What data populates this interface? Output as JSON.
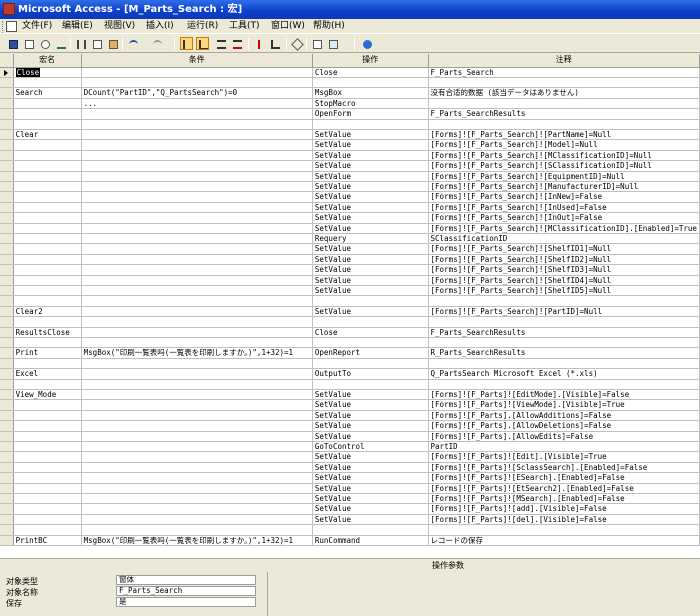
{
  "window": {
    "title": "Microsoft Access - [M_Parts_Search : 宏]"
  },
  "menu": [
    {
      "label": "文件(F)",
      "name": "file"
    },
    {
      "label": "编辑(E)",
      "name": "edit"
    },
    {
      "label": "视图(V)",
      "name": "view"
    },
    {
      "label": "插入(I)",
      "name": "insert"
    },
    {
      "label": "运行(R)",
      "name": "run"
    },
    {
      "label": "工具(T)",
      "name": "tools"
    },
    {
      "label": "窗口(W)",
      "name": "window"
    },
    {
      "label": "帮助(H)",
      "name": "help"
    }
  ],
  "toolbar": {
    "icons": [
      "save-icon",
      "print-icon",
      "print-preview-icon",
      "spell-check-icon",
      "cut-icon",
      "copy-icon",
      "paste-icon",
      "undo-icon",
      "redo-icon",
      "macro-names-icon",
      "conditions-icon",
      "insert-rows-icon",
      "delete-rows-icon",
      "run-icon",
      "single-step-icon",
      "build-icon",
      "database-window-icon",
      "new-object-icon",
      "help-icon"
    ],
    "colors": {
      "highlight": "#ffd67a"
    }
  },
  "grid": {
    "headers": {
      "macro_name": "宏名",
      "condition": "条件",
      "action": "操作",
      "comment": "注释"
    },
    "rows": [
      {
        "name": "Close",
        "cond": "",
        "action": "Close",
        "comment": "F_Parts_Search",
        "current": true
      },
      {
        "name": "",
        "cond": "",
        "action": "",
        "comment": ""
      },
      {
        "name": "Search",
        "cond": "DCount(\"PartID\",\"Q_PartsSearch\")=0",
        "action": "MsgBox",
        "comment": "没有合适的数据 (該当データはありません)"
      },
      {
        "name": "",
        "cond": "...",
        "action": "StopMacro",
        "comment": ""
      },
      {
        "name": "",
        "cond": "",
        "action": "OpenForm",
        "comment": "F_Parts_SearchResults"
      },
      {
        "name": "",
        "cond": "",
        "action": "",
        "comment": ""
      },
      {
        "name": "Clear",
        "cond": "",
        "action": "SetValue",
        "comment": "[Forms]![F_Parts_Search]![PartName]=Null"
      },
      {
        "name": "",
        "cond": "",
        "action": "SetValue",
        "comment": "[Forms]![F_Parts_Search]![Model]=Null"
      },
      {
        "name": "",
        "cond": "",
        "action": "SetValue",
        "comment": "[Forms]![F_Parts_Search]![MClassificationID]=Null"
      },
      {
        "name": "",
        "cond": "",
        "action": "SetValue",
        "comment": "[Forms]![F_Parts_Search]![SClassificationID]=Null"
      },
      {
        "name": "",
        "cond": "",
        "action": "SetValue",
        "comment": "[Forms]![F_Parts_Search]![EquipmentID]=Null"
      },
      {
        "name": "",
        "cond": "",
        "action": "SetValue",
        "comment": "[Forms]![F_Parts_Search]![ManufacturerID]=Null"
      },
      {
        "name": "",
        "cond": "",
        "action": "SetValue",
        "comment": "[Forms]![F_Parts_Search]![InNew]=False"
      },
      {
        "name": "",
        "cond": "",
        "action": "SetValue",
        "comment": "[Forms]![F_Parts_Search]![InUsed]=False"
      },
      {
        "name": "",
        "cond": "",
        "action": "SetValue",
        "comment": "[Forms]![F_Parts_Search]![InOut]=False"
      },
      {
        "name": "",
        "cond": "",
        "action": "SetValue",
        "comment": "[Forms]![F_Parts_Search]![MClassificationID].[Enabled]=True"
      },
      {
        "name": "",
        "cond": "",
        "action": "Requery",
        "comment": "SClassificationID"
      },
      {
        "name": "",
        "cond": "",
        "action": "SetValue",
        "comment": "[Forms]![F_Parts_Search]![ShelfID1]=Null"
      },
      {
        "name": "",
        "cond": "",
        "action": "SetValue",
        "comment": "[Forms]![F_Parts_Search]![ShelfID2]=Null"
      },
      {
        "name": "",
        "cond": "",
        "action": "SetValue",
        "comment": "[Forms]![F_Parts_Search]![ShelfID3]=Null"
      },
      {
        "name": "",
        "cond": "",
        "action": "SetValue",
        "comment": "[Forms]![F_Parts_Search]![ShelfID4]=Null"
      },
      {
        "name": "",
        "cond": "",
        "action": "SetValue",
        "comment": "[Forms]![F_Parts_Search]![ShelfID5]=Null"
      },
      {
        "name": "",
        "cond": "",
        "action": "",
        "comment": ""
      },
      {
        "name": "Clear2",
        "cond": "",
        "action": "SetValue",
        "comment": "[Forms]![F_Parts_Search]![PartID]=Null"
      },
      {
        "name": "",
        "cond": "",
        "action": "",
        "comment": ""
      },
      {
        "name": "ResultsClose",
        "cond": "",
        "action": "Close",
        "comment": "F_Parts_SearchResults"
      },
      {
        "name": "",
        "cond": "",
        "action": "",
        "comment": ""
      },
      {
        "name": "Print",
        "cond": "MsgBox(\"印刷一覧表吗(一覧表を印刷しますか。)\",1+32)=1",
        "action": "OpenReport",
        "comment": "R_Parts_SearchResults"
      },
      {
        "name": "",
        "cond": "",
        "action": "",
        "comment": ""
      },
      {
        "name": "Excel",
        "cond": "",
        "action": "OutputTo",
        "comment": "Q_PartsSearch  Microsoft Excel (*.xls)"
      },
      {
        "name": "",
        "cond": "",
        "action": "",
        "comment": ""
      },
      {
        "name": "View_Mode",
        "cond": "",
        "action": "SetValue",
        "comment": "[Forms]![F_Parts]![EditMode].[Visible]=False"
      },
      {
        "name": "",
        "cond": "",
        "action": "SetValue",
        "comment": "[Forms]![F_Parts]![ViewMode].[Visible]=True"
      },
      {
        "name": "",
        "cond": "",
        "action": "SetValue",
        "comment": "[Forms]![F_Parts].[AllowAdditions]=False"
      },
      {
        "name": "",
        "cond": "",
        "action": "SetValue",
        "comment": "[Forms]![F_Parts].[AllowDeletions]=False"
      },
      {
        "name": "",
        "cond": "",
        "action": "SetValue",
        "comment": "[Forms]![F_Parts].[AllowEdits]=False"
      },
      {
        "name": "",
        "cond": "",
        "action": "GoToControl",
        "comment": "PartID"
      },
      {
        "name": "",
        "cond": "",
        "action": "SetValue",
        "comment": "[Forms]![F_Parts]![Edit].[Visible]=True"
      },
      {
        "name": "",
        "cond": "",
        "action": "SetValue",
        "comment": "[Forms]![F_Parts]![SclassSearch].[Enabled]=False"
      },
      {
        "name": "",
        "cond": "",
        "action": "SetValue",
        "comment": "[Forms]![F_Parts]![ESearch].[Enabled]=False"
      },
      {
        "name": "",
        "cond": "",
        "action": "SetValue",
        "comment": "[Forms]![F_Parts]![EtSearch2].[Enabled]=False"
      },
      {
        "name": "",
        "cond": "",
        "action": "SetValue",
        "comment": "[Forms]![F_Parts]![MSearch].[Enabled]=False"
      },
      {
        "name": "",
        "cond": "",
        "action": "SetValue",
        "comment": "[Forms]![F_Parts]![add].[Visible]=False"
      },
      {
        "name": "",
        "cond": "",
        "action": "SetValue",
        "comment": "[Forms]![F_Parts]![del].[Visible]=False"
      },
      {
        "name": "",
        "cond": "",
        "action": "",
        "comment": ""
      },
      {
        "name": "PrintBC",
        "cond": "MsgBox(\"印刷一覧表吗(一覧表を印刷しますか。)\",1+32)=1",
        "action": "RunCommand",
        "comment": "レコードの保存"
      }
    ]
  },
  "params": {
    "header": "操作参数",
    "fields": [
      {
        "label": "对象类型",
        "value": "窗体"
      },
      {
        "label": "对象名称",
        "value": "F_Parts_Search"
      },
      {
        "label": "保存",
        "value": "是"
      }
    ]
  }
}
